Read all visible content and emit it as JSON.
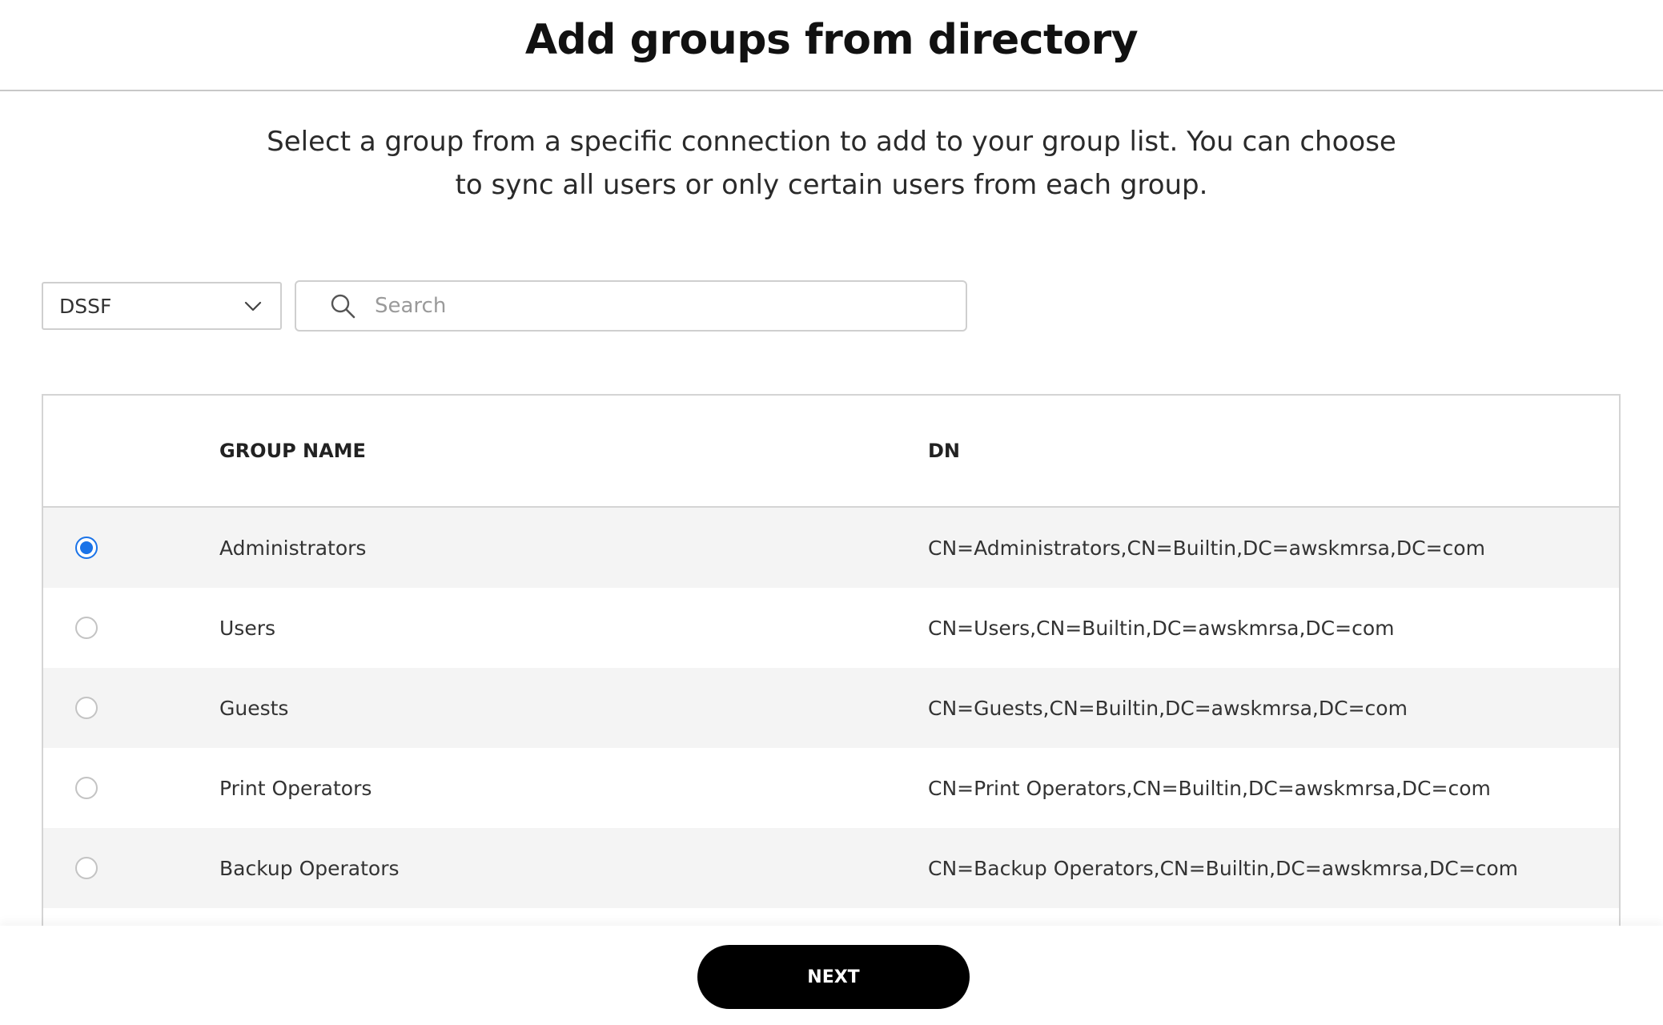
{
  "header": {
    "title": "Add groups from directory"
  },
  "description": {
    "line1": "Select a group from a specific connection to add to your group list. You can choose",
    "line2": "to sync all users or only certain users from each group."
  },
  "connection_select": {
    "value": "DSSF",
    "icon": "chevron-down-icon"
  },
  "search": {
    "placeholder": "Search",
    "value": "",
    "icon": "search-icon"
  },
  "table": {
    "columns": [
      "GROUP NAME",
      "DN"
    ],
    "rows": [
      {
        "selected": true,
        "name": "Administrators",
        "dn": "CN=Administrators,CN=Builtin,DC=awskmrsa,DC=com"
      },
      {
        "selected": false,
        "name": "Users",
        "dn": "CN=Users,CN=Builtin,DC=awskmrsa,DC=com"
      },
      {
        "selected": false,
        "name": "Guests",
        "dn": "CN=Guests,CN=Builtin,DC=awskmrsa,DC=com"
      },
      {
        "selected": false,
        "name": "Print Operators",
        "dn": "CN=Print Operators,CN=Builtin,DC=awskmrsa,DC=com"
      },
      {
        "selected": false,
        "name": "Backup Operators",
        "dn": "CN=Backup Operators,CN=Builtin,DC=awskmrsa,DC=com"
      }
    ]
  },
  "footer": {
    "next_label": "NEXT"
  },
  "colors": {
    "accent": "#1a73e8",
    "button_bg": "#000000",
    "row_alt": "#f4f4f4"
  }
}
